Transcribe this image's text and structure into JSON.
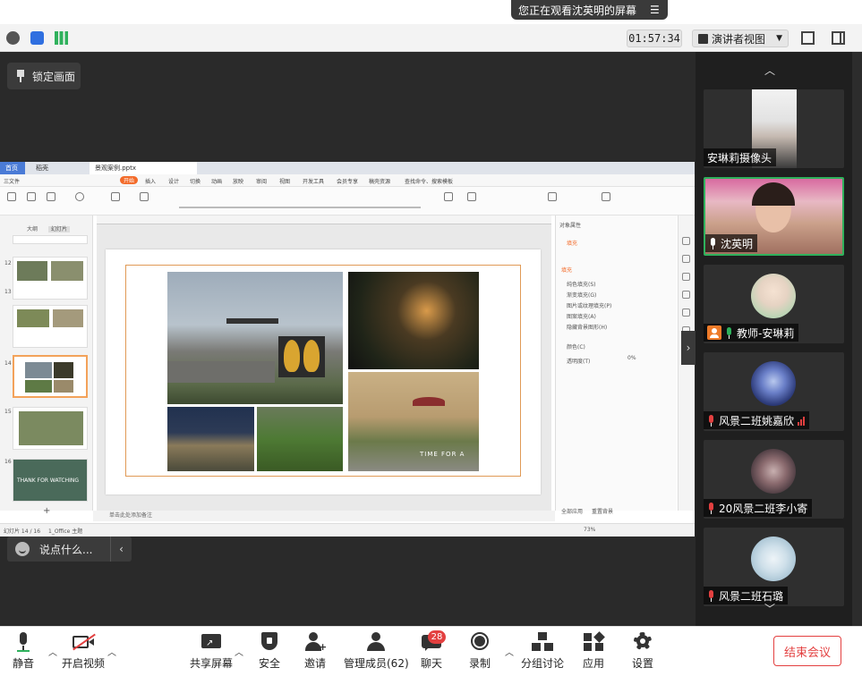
{
  "banner": {
    "sharing_text": "您正在观看沈英明的屏幕"
  },
  "status": {
    "timer": "01:57:34",
    "view_mode": "演讲者视图"
  },
  "stage": {
    "lock_label": "锁定画面"
  },
  "chat": {
    "placeholder": "说点什么..."
  },
  "shared_app": {
    "tabs": [
      "首页",
      "稻壳",
      "景观案例.pptx"
    ],
    "menu": [
      "三文件",
      "开始",
      "插入",
      "设计",
      "切换",
      "动画",
      "放映",
      "审阅",
      "视图",
      "开发工具",
      "会员专享",
      "稿壳资源",
      "查找命令、搜索模板"
    ],
    "thumb_tabs": [
      "大纲",
      "幻灯片"
    ],
    "thumb_numbers": [
      "12",
      "13",
      "14",
      "15",
      "16"
    ],
    "note_placeholder": "单击此处添加备注",
    "status_text": "幻灯片 14 / 16",
    "theme_text": "1_Office 主题",
    "zoom": "73%",
    "props_title": "对象属性",
    "props_tab": "填充",
    "props_options": [
      "纯色填充(S)",
      "渐变填充(G)",
      "图片或纹理填充(P)",
      "图案填充(A)",
      "隐藏背景图形(H)"
    ],
    "props_color": "颜色(C)",
    "props_transparency": "透明度(T)",
    "props_transparency_value": "0%",
    "props_buttons": [
      "全部应用",
      "重置背景"
    ],
    "slide16_text": "THANK FOR WATCHING",
    "photo_text": "TIME FOR A"
  },
  "participants": [
    {
      "name": "安琳莉摄像头",
      "mic": "none"
    },
    {
      "name": "沈英明",
      "mic": "active"
    },
    {
      "name": "教师-安琳莉",
      "mic": "green",
      "host": true
    },
    {
      "name": "风景二班姚嘉欣",
      "mic": "muted",
      "signal": true
    },
    {
      "name": "20风景二班李小寄",
      "mic": "muted"
    },
    {
      "name": "风景二班石璐",
      "mic": "muted"
    }
  ],
  "toolbar": {
    "mute": "静音",
    "video": "开启视频",
    "share": "共享屏幕",
    "security": "安全",
    "invite": "邀请",
    "members": "管理成员(62)",
    "chat": "聊天",
    "chat_badge": "28",
    "record": "录制",
    "breakout": "分组讨论",
    "apps": "应用",
    "settings": "设置",
    "end": "结束会议"
  },
  "colors": {
    "accent_green": "#2fb15c",
    "danger": "#e34040",
    "wps_orange": "#f36b2a"
  }
}
